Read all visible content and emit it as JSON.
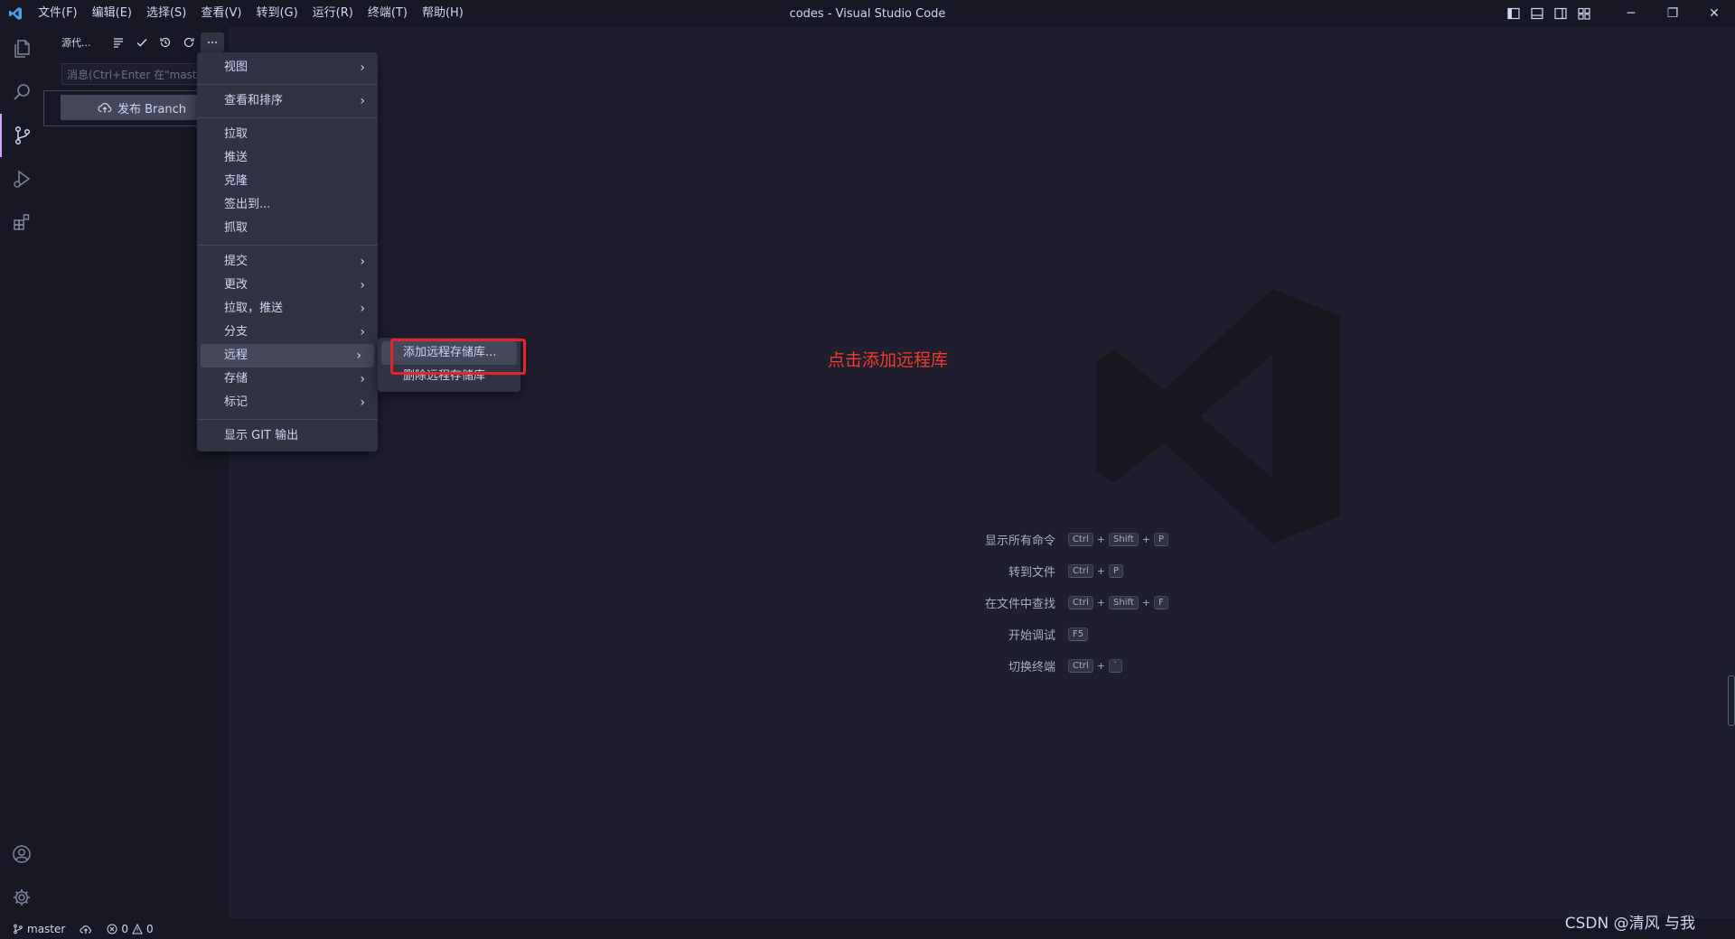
{
  "titlebar": {
    "menus": [
      "文件(F)",
      "编辑(E)",
      "选择(S)",
      "查看(V)",
      "转到(G)",
      "运行(R)",
      "终端(T)",
      "帮助(H)"
    ],
    "window_title": "codes - Visual Studio Code",
    "minimize": "─",
    "restore": "❐",
    "close": "✕"
  },
  "sidebar": {
    "title": "源代...",
    "message_placeholder": "消息(Ctrl+Enter 在\"master\"提交)",
    "publish_label": "发布 Branch"
  },
  "context_menu": {
    "items": [
      "视图",
      "查看和排序",
      "拉取",
      "推送",
      "克隆",
      "签出到...",
      "抓取",
      "提交",
      "更改",
      "拉取，推送",
      "分支",
      "远程",
      "存储",
      "标记",
      "显示 GIT 输出"
    ],
    "arrow": "›"
  },
  "submenu": {
    "items": [
      "添加远程存储库...",
      "删除远程存储库"
    ]
  },
  "annotation": "点击添加远程库",
  "hints": [
    {
      "label": "显示所有命令",
      "keys": [
        "Ctrl",
        "Shift",
        "P"
      ]
    },
    {
      "label": "转到文件",
      "keys": [
        "Ctrl",
        "P"
      ]
    },
    {
      "label": "在文件中查找",
      "keys": [
        "Ctrl",
        "Shift",
        "F"
      ]
    },
    {
      "label": "开始调试",
      "keys": [
        "F5"
      ]
    },
    {
      "label": "切换终端",
      "keys": [
        "Ctrl",
        "`"
      ]
    }
  ],
  "statusbar": {
    "branch": "master",
    "errors": "0",
    "warnings": "0"
  },
  "credit": "CSDN @清风 与我",
  "colors": {
    "accent": "#cba6f7",
    "annotation_red": "#f03c28",
    "highlight_box": "#e3242b"
  }
}
